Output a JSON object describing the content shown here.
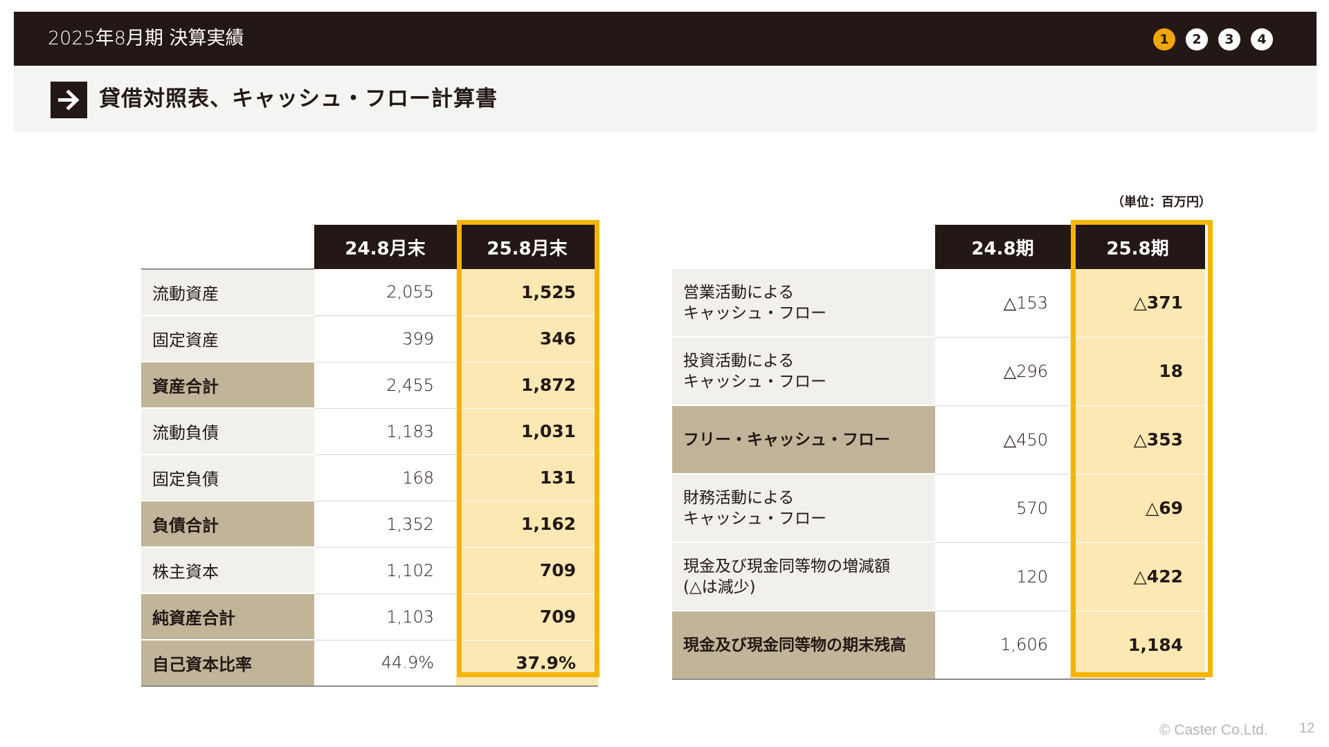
{
  "header": {
    "title": "2025年8月期 決算実績",
    "steps": [
      "1",
      "2",
      "3",
      "4"
    ],
    "active_step": "1",
    "active_color": "#f0a70a"
  },
  "section": {
    "title": "貸借対照表、キャッシュ・フロー計算書",
    "icon": "arrow-right-icon"
  },
  "unit_label": "（単位：百万円）",
  "balance_sheet": {
    "columns": [
      "24.8月末",
      "25.8月末"
    ],
    "rows": [
      {
        "label": "流動資産",
        "v24": "2,055",
        "v25": "1,525",
        "total": false
      },
      {
        "label": "固定資産",
        "v24": "399",
        "v25": "346",
        "total": false
      },
      {
        "label": "資産合計",
        "v24": "2,455",
        "v25": "1,872",
        "total": true
      },
      {
        "label": "流動負債",
        "v24": "1,183",
        "v25": "1,031",
        "total": false
      },
      {
        "label": "固定負債",
        "v24": "168",
        "v25": "131",
        "total": false
      },
      {
        "label": "負債合計",
        "v24": "1,352",
        "v25": "1,162",
        "total": true
      },
      {
        "label": "株主資本",
        "v24": "1,102",
        "v25": "709",
        "total": false
      },
      {
        "label": "純資産合計",
        "v24": "1,103",
        "v25": "709",
        "total": true
      },
      {
        "label": "自己資本比率",
        "v24": "44.9%",
        "v25": "37.9%",
        "total": true
      }
    ]
  },
  "cash_flow": {
    "columns": [
      "24.8期",
      "25.8期"
    ],
    "rows": [
      {
        "label_1": "営業活動による",
        "label_2": "キャッシュ・フロー",
        "v24": "△153",
        "v25": "△371",
        "total": false
      },
      {
        "label_1": "投資活動による",
        "label_2": "キャッシュ・フロー",
        "v24": "△296",
        "v25": "18",
        "total": false
      },
      {
        "label_1": "フリー・キャッシュ・フロー",
        "label_2": "",
        "v24": "△450",
        "v25": "△353",
        "total": true
      },
      {
        "label_1": "財務活動による",
        "label_2": "キャッシュ・フロー",
        "v24": "570",
        "v25": "△69",
        "total": false
      },
      {
        "label_1": "現金及び現金同等物の増減額",
        "label_2": "(△は減少)",
        "v24": "120",
        "v25": "△422",
        "total": false
      },
      {
        "label_1": "現金及び現金同等物の期末残高",
        "label_2": "",
        "v24": "1,606",
        "v25": "1,184",
        "total": true
      }
    ]
  },
  "colors": {
    "dark": "#231815",
    "highlight_border": "#f4b400",
    "highlight_fill": "#fce8b2",
    "total_fill": "#c1b599",
    "label_fill": "#f1f0ec"
  },
  "footer": {
    "copyright": "© Caster Co.Ltd.",
    "page_number": "12"
  }
}
